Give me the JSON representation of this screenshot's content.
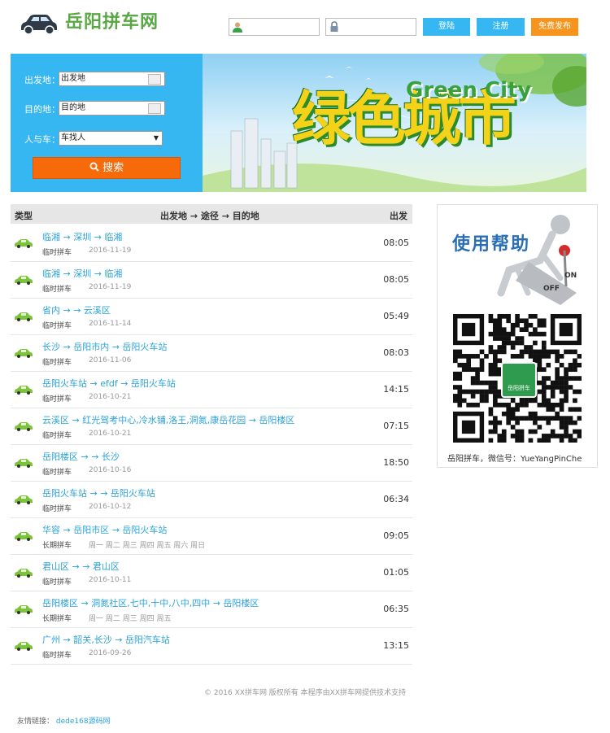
{
  "header": {
    "site_name": "岳阳拼车网",
    "login_label": "登陆",
    "register_label": "注册",
    "publish_label": "免费发布",
    "colors": {
      "brand_green": "#5aa845",
      "button_blue": "#36b7f1",
      "button_orange": "#f7941d"
    }
  },
  "search": {
    "from_label": "出发地：",
    "from_value": "出发地",
    "to_label": "目的地：",
    "to_value": "目的地",
    "type_label": "人与车：",
    "type_value": "车找人",
    "search_label": "搜索"
  },
  "banner": {
    "green_city": "Green City",
    "chars": "绿色城市"
  },
  "table": {
    "headers": {
      "type": "类型",
      "route": "出发地 → 途径 → 目的地",
      "time": "出发"
    },
    "rows": [
      {
        "route": "临湘 → 深圳 → 临湘",
        "kind": "临时拼车",
        "date": "2016-11-19",
        "time": "08:05"
      },
      {
        "route": "临湘 → 深圳 → 临湘",
        "kind": "临时拼车",
        "date": "2016-11-19",
        "time": "08:05"
      },
      {
        "route": "省内 → → 云溪区",
        "kind": "临时拼车",
        "date": "2016-11-14",
        "time": "05:49"
      },
      {
        "route": "长沙 → 岳阳市内 → 岳阳火车站",
        "kind": "临时拼车",
        "date": "2016-11-06",
        "time": "08:03"
      },
      {
        "route": "岳阳火车站 → efdf → 岳阳火车站",
        "kind": "临时拼车",
        "date": "2016-10-21",
        "time": "14:15"
      },
      {
        "route": "云溪区 → 红光驾考中心,冷水铺,洛王,洞氮,康岳花园 → 岳阳楼区",
        "kind": "临时拼车",
        "date": "2016-10-21",
        "time": "07:15"
      },
      {
        "route": "岳阳楼区 → → 长沙",
        "kind": "临时拼车",
        "date": "2016-10-16",
        "time": "18:50"
      },
      {
        "route": "岳阳火车站 → → 岳阳火车站",
        "kind": "临时拼车",
        "date": "2016-10-12",
        "time": "06:34"
      },
      {
        "route": "华容 → 岳阳市区 → 岳阳火车站",
        "kind": "长期拼车",
        "date": "周一 周二 周三 周四 周五 周六 周日",
        "time": "09:05"
      },
      {
        "route": "君山区 → → 君山区",
        "kind": "临时拼车",
        "date": "2016-10-11",
        "time": "01:05"
      },
      {
        "route": "岳阳楼区 → 洞氮社区,七中,十中,八中,四中 → 岳阳楼区",
        "kind": "长期拼车",
        "date": "周一 周二 周三 周四 周五",
        "time": "06:35"
      },
      {
        "route": "广州 → 韶关,长沙 → 岳阳汽车站",
        "kind": "临时拼车",
        "date": "2016-09-26",
        "time": "13:15"
      }
    ]
  },
  "sidebar": {
    "help_title": "使用帮助",
    "switch_on": "ON",
    "switch_off": "OFF",
    "qr_center": "岳阳拼车",
    "wechat_text": "岳阳拼车，微信号：YueYangPinChe"
  },
  "footer": {
    "copyright": "© 2016 XX拼车网 版权所有 本程序由XX拼车网提供技术支持",
    "links_label": "友情链接：",
    "link_1": "dede168源码网"
  }
}
